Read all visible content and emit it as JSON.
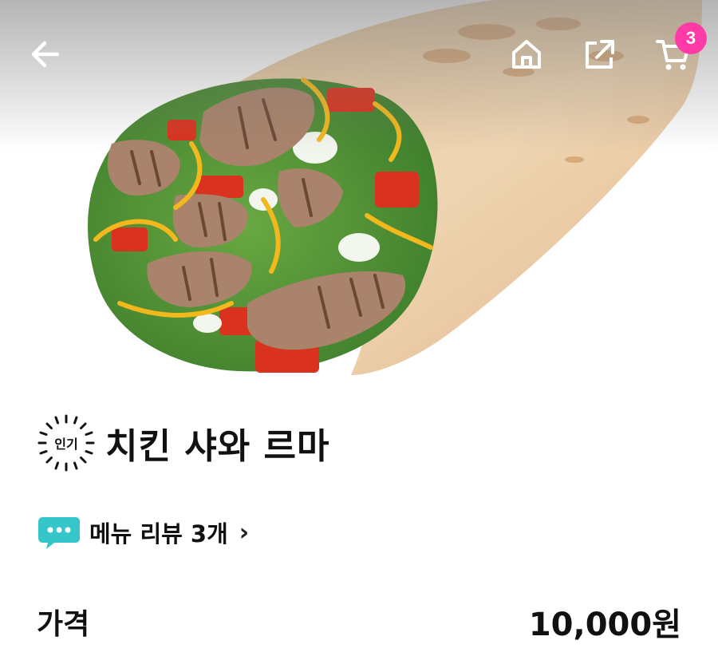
{
  "header": {
    "back_icon": "arrow-left-icon",
    "home_icon": "home-icon",
    "share_icon": "share-icon",
    "cart_icon": "cart-icon",
    "cart_count": "3"
  },
  "hero": {
    "image": "chicken shawarma wrap photo"
  },
  "menu": {
    "badge": "인기",
    "title": "치킨 샤와 르마"
  },
  "review": {
    "icon": "chat-bubble-icon",
    "label": "메뉴 리뷰 3개",
    "chevron": "›"
  },
  "price": {
    "label": "가격",
    "value": "10,000원"
  },
  "colors": {
    "badge_pink": "#ff3aa7",
    "chat_teal": "#36c6c9",
    "text": "#111111"
  }
}
